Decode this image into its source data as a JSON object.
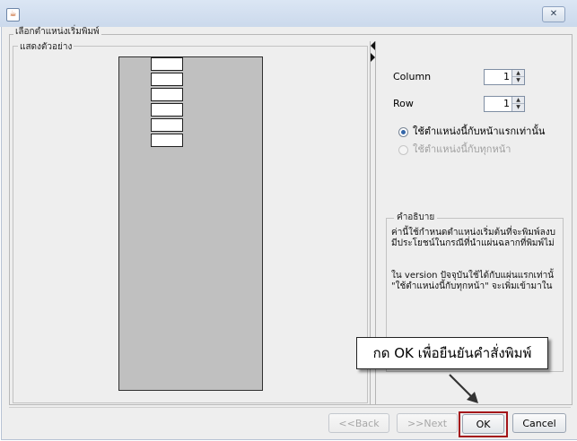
{
  "window": {
    "close_label": "✕"
  },
  "groups": {
    "main_title": "เลือกตำแหน่งเริ่มพิมพ์",
    "preview_title": "แสดงตัวอย่าง"
  },
  "preview": {
    "label_rows": 6
  },
  "settings": {
    "column_label": "Column",
    "column_value": "1",
    "row_label": "Row",
    "row_value": "1",
    "radio_first_page": "ใช้ตำแหน่งนี้กับหน้าแรกเท่านั้น",
    "radio_first_page_selected": true,
    "radio_all_pages": "ใช้ตำแหน่งนี้กับทุกหน้า",
    "radio_all_pages_enabled": false
  },
  "description": {
    "title": "คำอธิบาย",
    "lines": [
      "ค่านี้ใช้กำหนดตำแหน่งเริ่มต้นที่จะพิมพ์ลงบ",
      "มีประโยชน์ในกรณีที่นำแผ่นฉลากที่พิมพ์ไม่",
      "",
      "",
      "ใน version ปัจจุบันใช้ได้กับแผ่นแรกเท่านั้",
      "\"ใช้ตำแหน่งนี้กับทุกหน้า\" จะเพิ่มเข้ามาใน"
    ]
  },
  "buttons": {
    "back": "<<Back",
    "next": ">>Next",
    "ok": "OK",
    "cancel": "Cancel"
  },
  "annotation": {
    "callout_text": "กด OK เพื่อยืนยันคำสั่งพิมพ์",
    "highlight_color": "#a4141a"
  }
}
